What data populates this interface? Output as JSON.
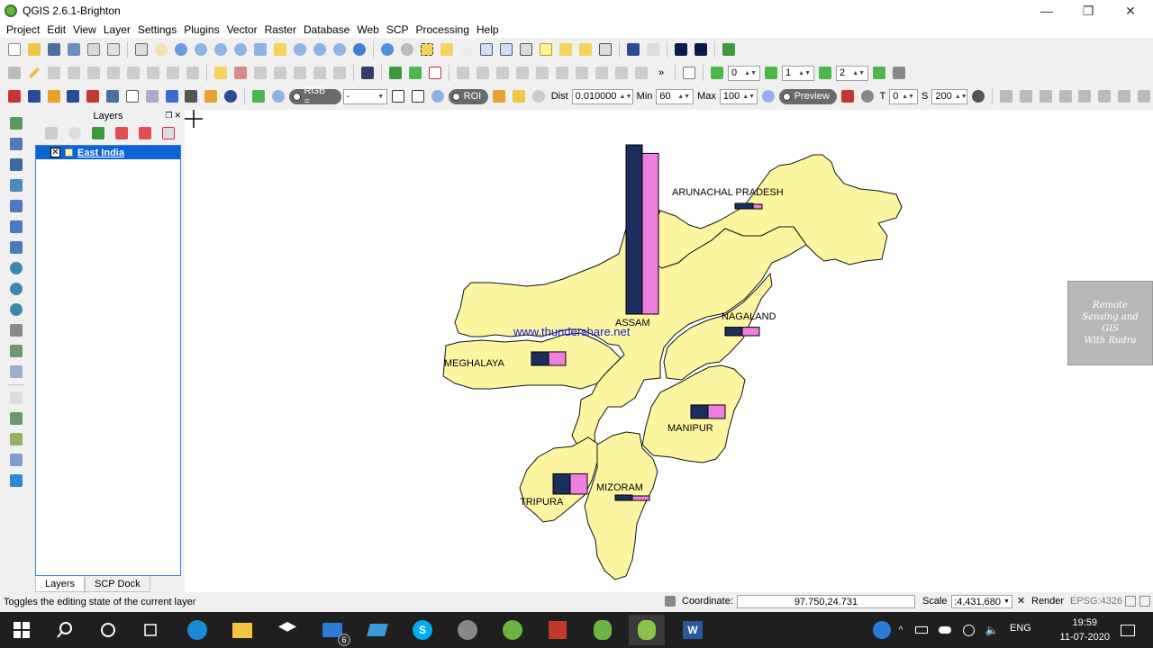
{
  "window": {
    "title": "QGIS 2.6.1-Brighton",
    "minimize": "—",
    "restore": "❐",
    "close": "✕"
  },
  "menu": [
    "Project",
    "Edit",
    "View",
    "Layer",
    "Settings",
    "Plugins",
    "Vector",
    "Raster",
    "Database",
    "Web",
    "SCP",
    "Processing",
    "Help"
  ],
  "toolbar3": {
    "spin_a": "0",
    "spin_b": "1",
    "spin_c": "2",
    "rgb_label": "RGB =",
    "rgb_value": "-",
    "roi_label": "ROI",
    "dist_label": "Dist",
    "dist_value": "0.010000",
    "min_label": "Min",
    "min_value": "60",
    "max_label": "Max",
    "max_value": "100",
    "preview_label": "Preview",
    "t_label": "T",
    "t_value": "0",
    "s_label": "S",
    "s_value": "200"
  },
  "layers_panel": {
    "title": "Layers",
    "layers": [
      {
        "name": "East India",
        "checked": "✕"
      }
    ],
    "tabs": [
      "Layers",
      "SCP Dock"
    ]
  },
  "map": {
    "fill_color": "#fdf5a0",
    "bar_color_1": "#1b2e5e",
    "bar_color_2": "#ee7ee0",
    "watermark_url": "www.thundershare.net",
    "logo_text": [
      "Remote",
      "Sensing and",
      "GIS",
      "With Rudra"
    ],
    "states": [
      {
        "name": "ARUNACHAL PRADESH",
        "v1": 2,
        "v2": 2
      },
      {
        "name": "ASSAM",
        "v1": 100,
        "v2": 95
      },
      {
        "name": "NAGALAND",
        "v1": 5,
        "v2": 5
      },
      {
        "name": "MEGHALAYA",
        "v1": 8,
        "v2": 8
      },
      {
        "name": "MANIPUR",
        "v1": 8,
        "v2": 8
      },
      {
        "name": "MIZORAM",
        "v1": 2,
        "v2": 2
      },
      {
        "name": "TRIPURA",
        "v1": 12,
        "v2": 12
      }
    ]
  },
  "status": {
    "message": "Toggles the editing state of the current layer",
    "coordinate_label": "Coordinate:",
    "coordinate_value": "97.750,24.731",
    "scale_label": "Scale",
    "scale_value": ":4,431,680",
    "render_label": "Render",
    "crs": "EPSG:4326"
  },
  "taskbar": {
    "mail_badge": "6",
    "lang": "ENG",
    "time": "19:59",
    "date": "11-07-2020"
  }
}
